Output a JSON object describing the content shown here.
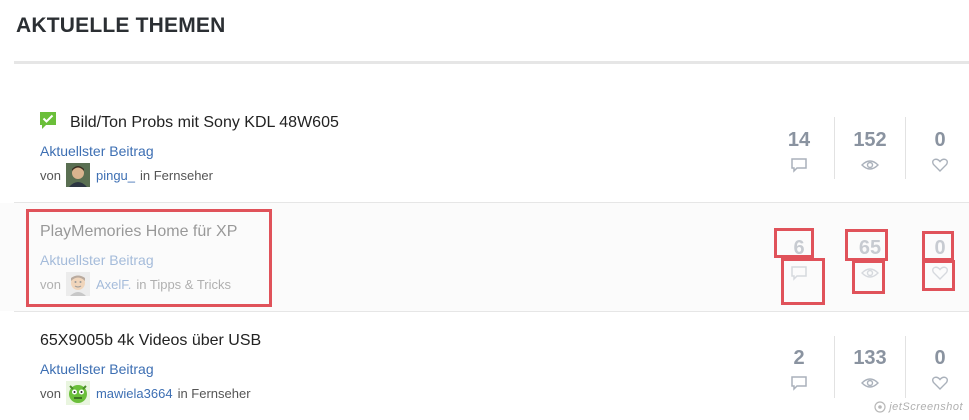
{
  "section": {
    "title": "AKTUELLE THEMEN"
  },
  "topics": [
    {
      "title": "Bild/Ton Probs mit Sony KDL 48W605",
      "latest_label": "Aktuellster Beitrag",
      "by_label": "von",
      "user": "pingu_",
      "forum": "in Fernseher",
      "replies": "14",
      "views": "152",
      "likes": "0",
      "solved_icon": "check-bubble-icon",
      "avatar_icon": "avatar-person-icon"
    },
    {
      "title": "PlayMemories Home für XP",
      "latest_label": "Aktuellster Beitrag",
      "by_label": "von",
      "user": "AxelF.",
      "forum": "in Tipps & Tricks",
      "replies": "6",
      "views": "65",
      "likes": "0",
      "avatar_icon": "avatar-cartoon-icon"
    },
    {
      "title": "65X9005b 4k Videos über USB",
      "latest_label": "Aktuellster Beitrag",
      "by_label": "von",
      "user": "mawiela3664",
      "forum": "in Fernseher",
      "replies": "2",
      "views": "133",
      "likes": "0",
      "avatar_icon": "avatar-monster-icon"
    }
  ],
  "icons": {
    "replies": "comment-icon",
    "views": "eye-icon",
    "likes": "heart-icon"
  },
  "colors": {
    "accent": "#3d6fb3",
    "solved_green": "#6bbf3a",
    "annotation": "#e0525a",
    "stat_gray": "#8a93a0"
  },
  "watermark": {
    "text": "jetScreenshot"
  }
}
